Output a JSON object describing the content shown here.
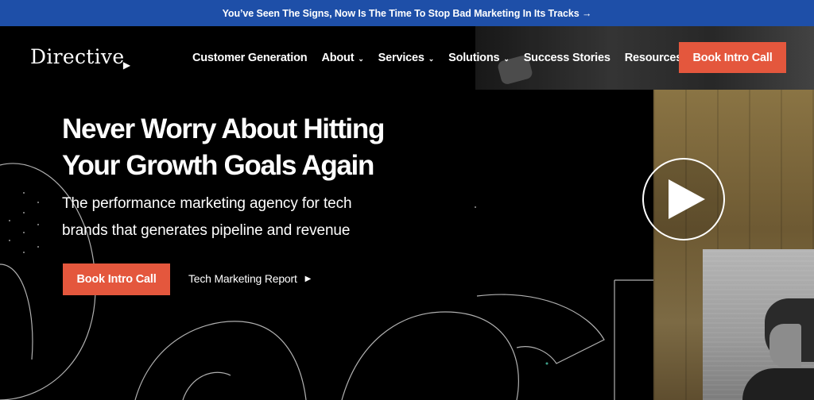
{
  "announcement": {
    "text": "You’ve Seen The Signs, Now Is The Time To Stop Bad Marketing In Its Tracks →"
  },
  "header": {
    "logo": "Directive",
    "nav": [
      {
        "label": "Customer Generation",
        "has_dropdown": false
      },
      {
        "label": "About",
        "has_dropdown": true
      },
      {
        "label": "Services",
        "has_dropdown": true
      },
      {
        "label": "Solutions",
        "has_dropdown": true
      },
      {
        "label": "Success Stories",
        "has_dropdown": false
      },
      {
        "label": "Resources",
        "has_dropdown": true
      }
    ],
    "cta": "Book Intro Call"
  },
  "hero": {
    "headline_line1": "Never Worry About Hitting",
    "headline_line2": "Your Growth Goals Again",
    "sub_line1": "The performance marketing agency for tech",
    "sub_line2": "brands that generates pipeline and revenue",
    "primary_cta": "Book Intro Call",
    "secondary_link": "Tech Marketing Report"
  },
  "colors": {
    "announcement_bg": "#1e4fa8",
    "accent": "#e4573d",
    "background": "#000000"
  },
  "icons": {
    "chevron": "chevron-down-icon",
    "play": "play-icon",
    "arrow": "triangle-right-icon"
  }
}
